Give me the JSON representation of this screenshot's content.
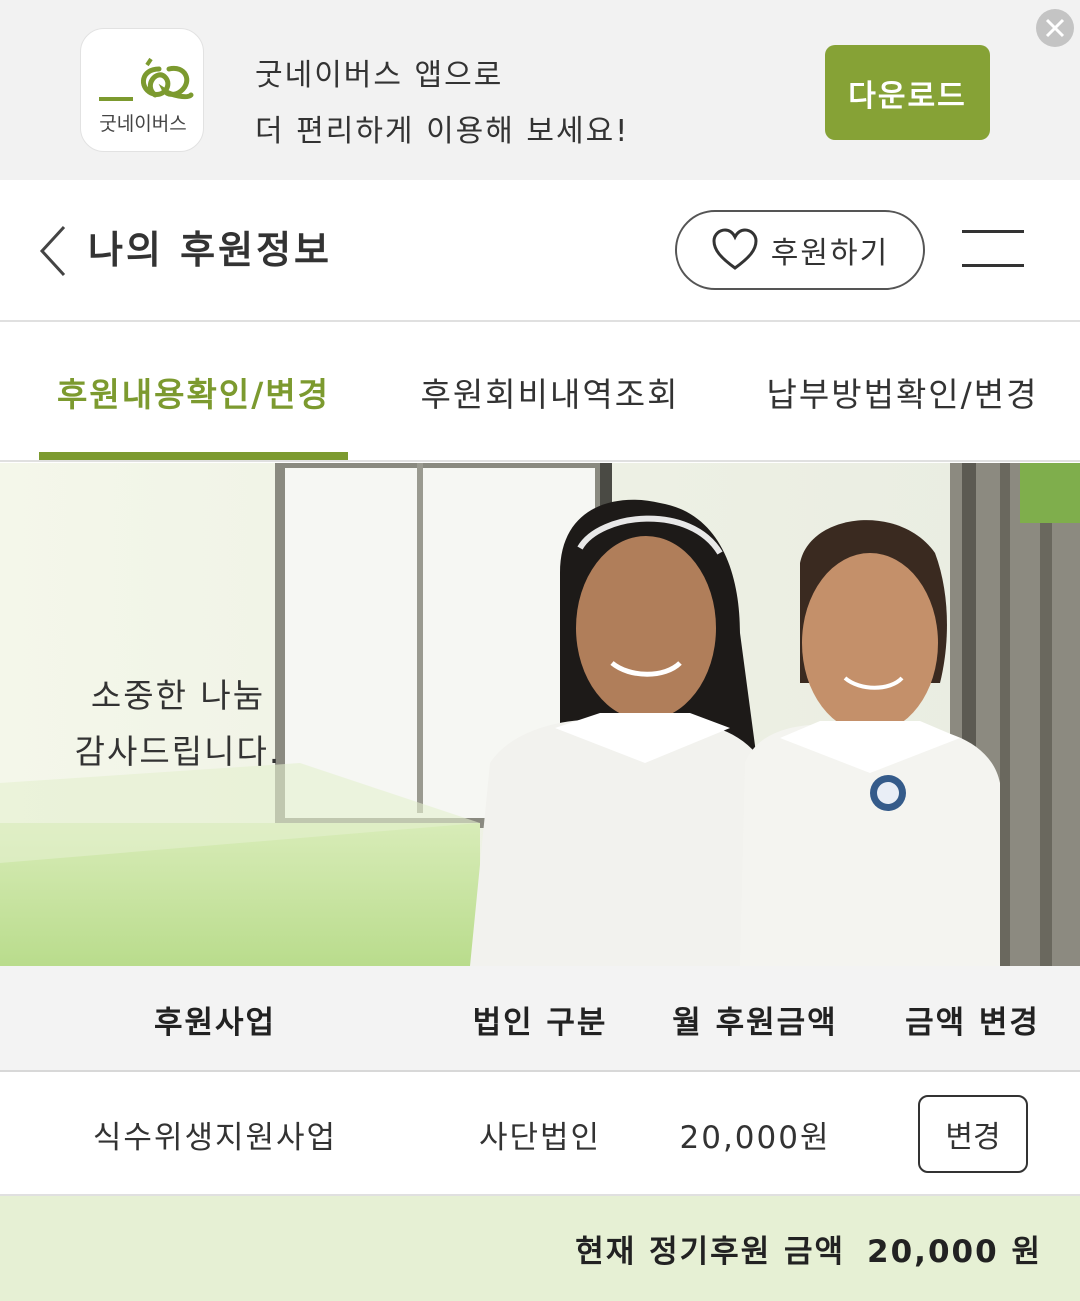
{
  "app_banner": {
    "app_name": "굿네이버스",
    "message_line1": "굿네이버스 앱으로",
    "message_line2": "더 편리하게 이용해 보세요!",
    "download_label": "다운로드",
    "accent_color": "#86a236"
  },
  "header": {
    "title": "나의 후원정보",
    "donate_label": "후원하기"
  },
  "tabs": [
    {
      "label": "후원내용확인/변경",
      "active": true
    },
    {
      "label": "후원회비내역조회",
      "active": false
    },
    {
      "label": "납부방법확인/변경",
      "active": false
    }
  ],
  "hero": {
    "line1": "소중한 나눔",
    "line2": "감사드립니다."
  },
  "table": {
    "headers": [
      "후원사업",
      "법인 구분",
      "월 후원금액",
      "금액 변경"
    ],
    "rows": [
      {
        "project": "식수위생지원사업",
        "entity": "사단법인",
        "amount": "20,000원",
        "action": "변경"
      }
    ]
  },
  "total": {
    "label": "현재 정기후원 금액",
    "amount": "20,000 원"
  }
}
